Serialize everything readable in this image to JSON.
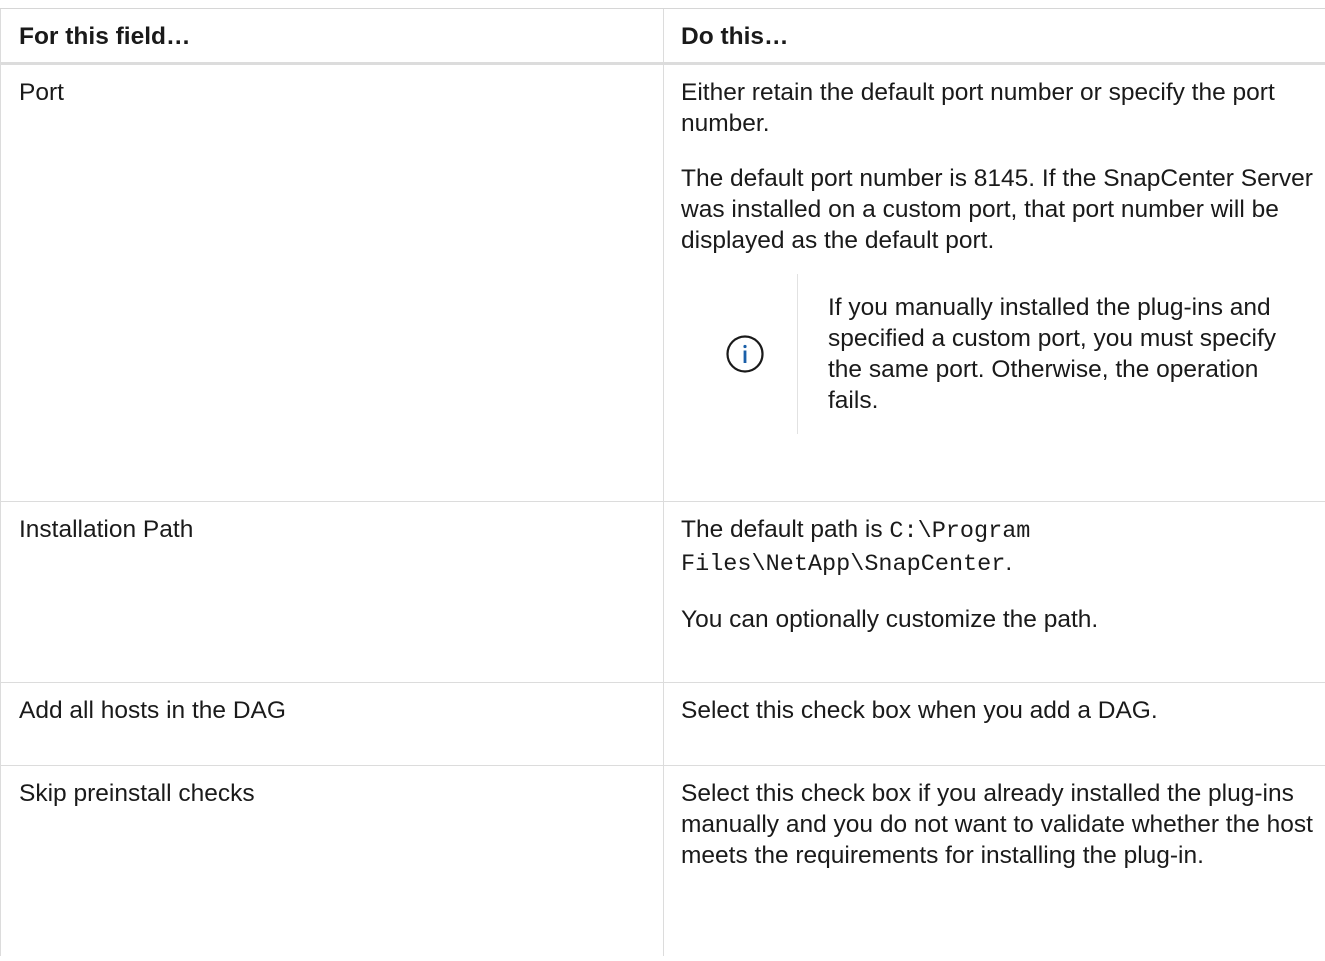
{
  "table": {
    "headers": {
      "field": "For this field…",
      "action": "Do this…"
    },
    "rows": [
      {
        "field": "Port",
        "paragraphs": [
          "Either retain the default port number or specify the port number.",
          "The default port number is 8145. If the SnapCenter Server was installed on a custom port, that port number will be displayed as the default port."
        ],
        "note": {
          "icon": "info-icon",
          "text": "If you manually installed the plug-ins and specified a custom port, you must specify the same port. Otherwise, the operation fails."
        }
      },
      {
        "field": "Installation Path",
        "path_prefix": "The default path is ",
        "path_code": "C:\\Program Files\\NetApp\\SnapCenter",
        "path_suffix": ".",
        "paragraph2": "You can optionally customize the path."
      },
      {
        "field": "Add all hosts in the DAG",
        "paragraph": "Select this check box when you add a DAG."
      },
      {
        "field": "Skip preinstall checks",
        "paragraph": "Select this check box if you already installed the plug-ins manually and you do not want to validate whether the host meets the requirements for installing the plug-in."
      }
    ]
  },
  "colors": {
    "border": "#dcdcdc",
    "text": "#1a1a1a",
    "icon": "#1a5fa8"
  }
}
